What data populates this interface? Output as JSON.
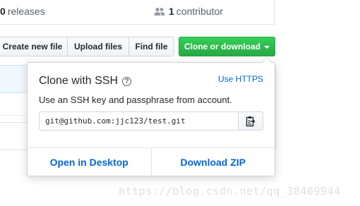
{
  "stats": {
    "releases_count": "0",
    "releases_label": "releases",
    "contributors_count": "1",
    "contributors_label": "contributor",
    "contributors_icon": "people-icon"
  },
  "toolbar": {
    "create_label": "Create new file",
    "upload_label": "Upload files",
    "find_label": "Find file",
    "clone_label": "Clone or download"
  },
  "clone_panel": {
    "title": "Clone with SSH",
    "help_icon": "question-icon",
    "switch_label": "Use HTTPS",
    "description": "Use an SSH key and passphrase from account.",
    "url": "git@github.com:jjc123/test.git",
    "copy_icon": "clipboard-icon",
    "open_desktop_label": "Open in Desktop",
    "download_zip_label": "Download ZIP"
  },
  "watermark": "https://blog.csdn.net/qq_38409944",
  "colors": {
    "accent_green": "#28a745",
    "link_blue": "#0366d6"
  }
}
